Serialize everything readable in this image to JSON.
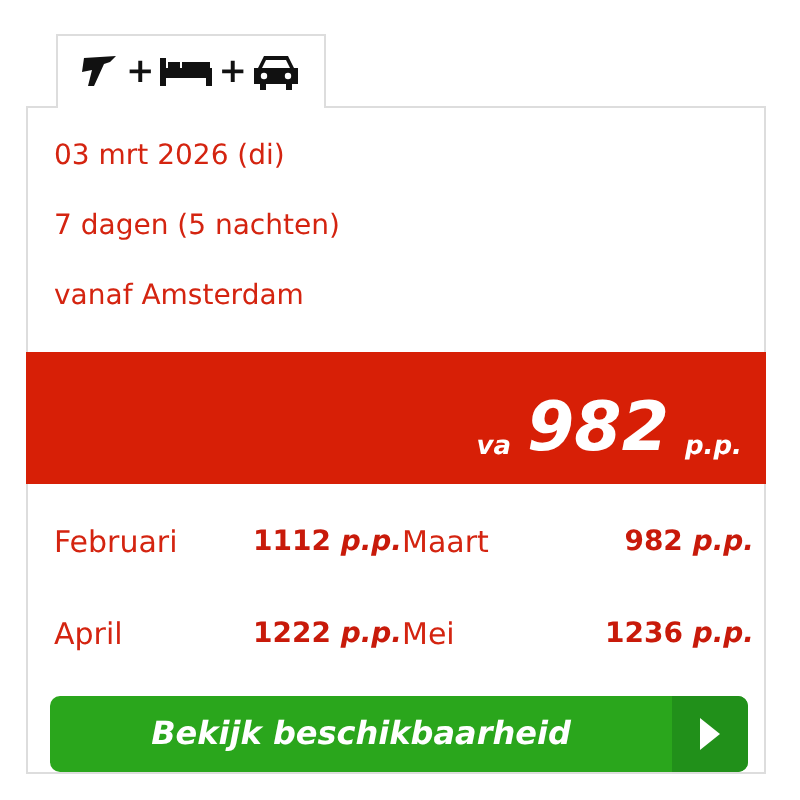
{
  "tab": {
    "plus_signs": [
      "+",
      "+"
    ]
  },
  "details": [
    "03 mrt 2026 (di)",
    "7 dagen (5 nachten)",
    "vanaf Amsterdam"
  ],
  "price_bar": {
    "prefix": "va",
    "price": "982",
    "unit": "p.p."
  },
  "months": [
    {
      "name": "Februari",
      "price": "1112",
      "unit": "p.p."
    },
    {
      "name": "Maart",
      "price": "982",
      "unit": "p.p."
    },
    {
      "name": "April",
      "price": "1222",
      "unit": "p.p."
    },
    {
      "name": "Mei",
      "price": "1236",
      "unit": "p.p."
    }
  ],
  "button": {
    "label": "Bekijk beschikbaarheid"
  }
}
